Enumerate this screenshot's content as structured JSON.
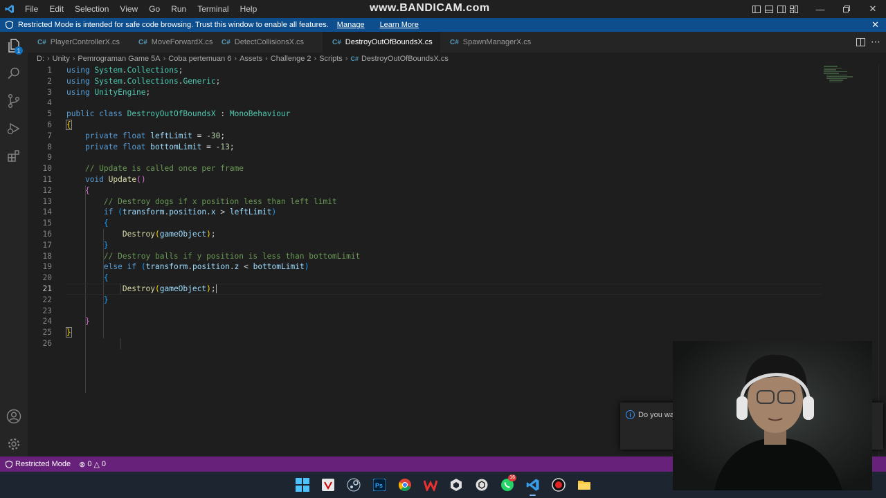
{
  "titlebar": {
    "menu": [
      "File",
      "Edit",
      "Selection",
      "View",
      "Go",
      "Run",
      "Terminal",
      "Help"
    ],
    "watermark": "www.BANDICAM.com"
  },
  "banner": {
    "message": "Restricted Mode is intended for safe code browsing. Trust this window to enable all features.",
    "manage": "Manage",
    "learn_more": "Learn More"
  },
  "activity_badge": "1",
  "tabs": [
    {
      "label": "PlayerControllerX.cs",
      "icon": "C#"
    },
    {
      "label": "MoveForwardX.cs",
      "icon": "C#"
    },
    {
      "label": "DetectCollisionsX.cs",
      "icon": "C#"
    },
    {
      "label": "DestroyOutOfBoundsX.cs",
      "icon": "C#"
    },
    {
      "label": "SpawnManagerX.cs",
      "icon": "C#"
    }
  ],
  "breadcrumb": {
    "parts": [
      "D:",
      "Unity",
      "Pemrograman Game 5A",
      "Coba pertemuan 6",
      "Assets",
      "Challenge 2",
      "Scripts"
    ],
    "file": "DestroyOutOfBoundsX.cs",
    "file_icon": "C#"
  },
  "code": {
    "line_numbers": [
      "1",
      "2",
      "3",
      "4",
      "5",
      "6",
      "7",
      "8",
      "9",
      "10",
      "11",
      "12",
      "13",
      "14",
      "15",
      "16",
      "17",
      "18",
      "19",
      "20",
      "21",
      "22",
      "23",
      "24",
      "25",
      "26"
    ],
    "comment_update": "// Update is called once per frame",
    "comment_dogs": "// Destroy dogs if x position less than left limit",
    "comment_balls": "// Destroy balls if y position is less than bottomLimit"
  },
  "notification": {
    "message": "Do you wa"
  },
  "statusbar": {
    "restricted": "Restricted Mode",
    "errors": "0",
    "warnings": "0"
  },
  "taskbar_badge": "16",
  "colors": {
    "statusbar": "#68217a",
    "banner": "#0e4e8c",
    "editor_bg": "#1e1e1e",
    "keyword": "#569cd6",
    "type": "#4ec9b0",
    "comment": "#6a9955"
  }
}
